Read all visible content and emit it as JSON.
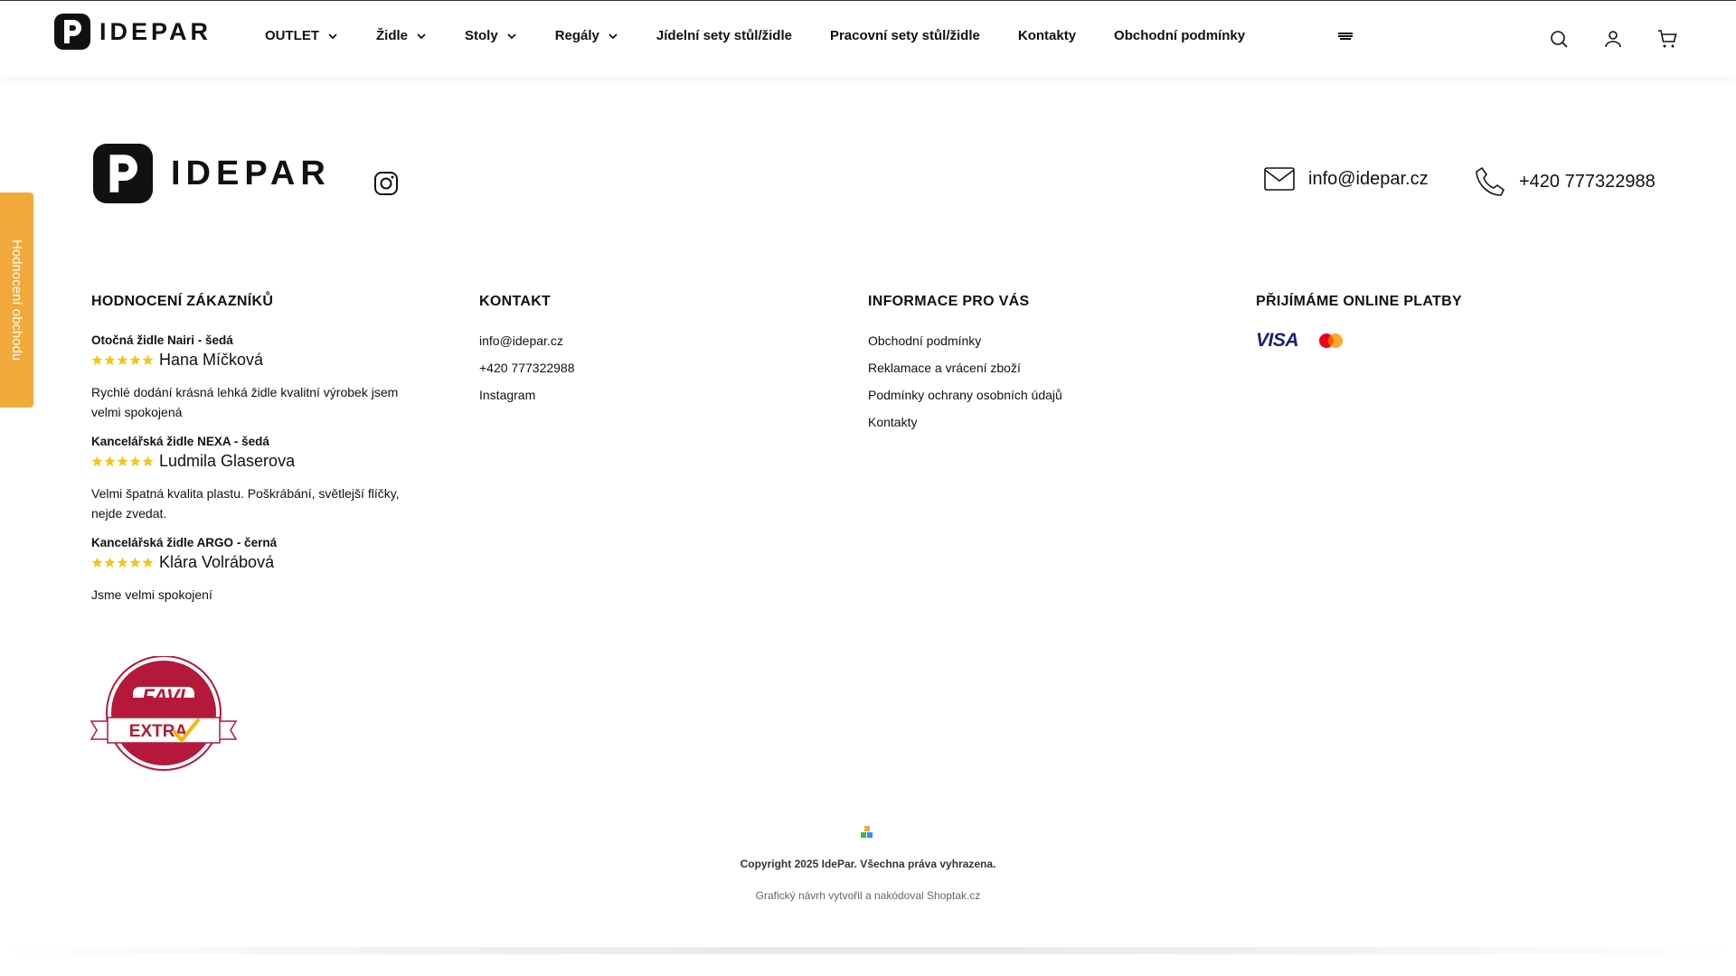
{
  "brand": {
    "name": "IDEPAR"
  },
  "nav": {
    "items": [
      {
        "label": "OUTLET",
        "dropdown": true
      },
      {
        "label": "Židle",
        "dropdown": true
      },
      {
        "label": "Stoly",
        "dropdown": true
      },
      {
        "label": "Regály",
        "dropdown": true
      },
      {
        "label": "Jídelní sety stůl/židle",
        "dropdown": false
      },
      {
        "label": "Pracovní sety stůl/židle",
        "dropdown": false
      },
      {
        "label": "Kontakty",
        "dropdown": false
      },
      {
        "label": "Obchodní podmínky",
        "dropdown": false
      }
    ]
  },
  "side_tab": {
    "label": "Hodnocení obchodu"
  },
  "contact_top": {
    "email": "info@idepar.cz",
    "phone": "+420 777322988"
  },
  "columns": {
    "reviews": {
      "title": "HODNOCENÍ ZÁKAZNÍKŮ",
      "items": [
        {
          "product": "Otočná židle Nairi - šedá",
          "author": "Hana Míčková",
          "rating": 5,
          "text": "Rychlé dodání krásná lehká židle kvalitní výrobek jsem velmi spokojená"
        },
        {
          "product": "Kancelářská židle NEXA - šedá",
          "author": "Ludmila Glaserova",
          "rating": 5,
          "text": "Velmi špatná kvalita plastu. Poškrábání, světlejší flíčky, nejde zvedat."
        },
        {
          "product": "Kancelářská židle ARGO - černá",
          "author": "Klára Volrábová",
          "rating": 5,
          "text": "Jsme velmi spokojení"
        }
      ]
    },
    "contact": {
      "title": "KONTAKT",
      "links": [
        "info@idepar.cz",
        "+420 777322988",
        "Instagram"
      ]
    },
    "info": {
      "title": "INFORMACE PRO VÁS",
      "links": [
        "Obchodní podmínky",
        "Reklamace a vrácení zboží",
        "Podmínky ochrany osobních údajů",
        "Kontakty"
      ]
    },
    "payments": {
      "title": "PŘIJÍMÁME ONLINE PLATBY",
      "visa_label": "VISA"
    }
  },
  "favi_badge": {
    "top": "FAVI",
    "bottom": "EXTRA"
  },
  "footer": {
    "copyright": "Copyright 2025 IdePar. Všechna práva vyhrazena.",
    "credits": "Grafický návrh vytvořil a nakódoval Shoptak.cz"
  },
  "colors": {
    "accent": "#f2a93b",
    "star": "#f5c518",
    "favi_red": "#b5183a",
    "visa_blue": "#1a1f71",
    "mastercard_red": "#eb001b",
    "mastercard_yellow": "#f79e1b"
  },
  "icons": {
    "header": [
      "search-icon",
      "user-icon",
      "cart-icon"
    ],
    "menu": "hamburger-icon",
    "social": "instagram-icon",
    "email": "envelope-icon",
    "phone": "phone-icon"
  }
}
